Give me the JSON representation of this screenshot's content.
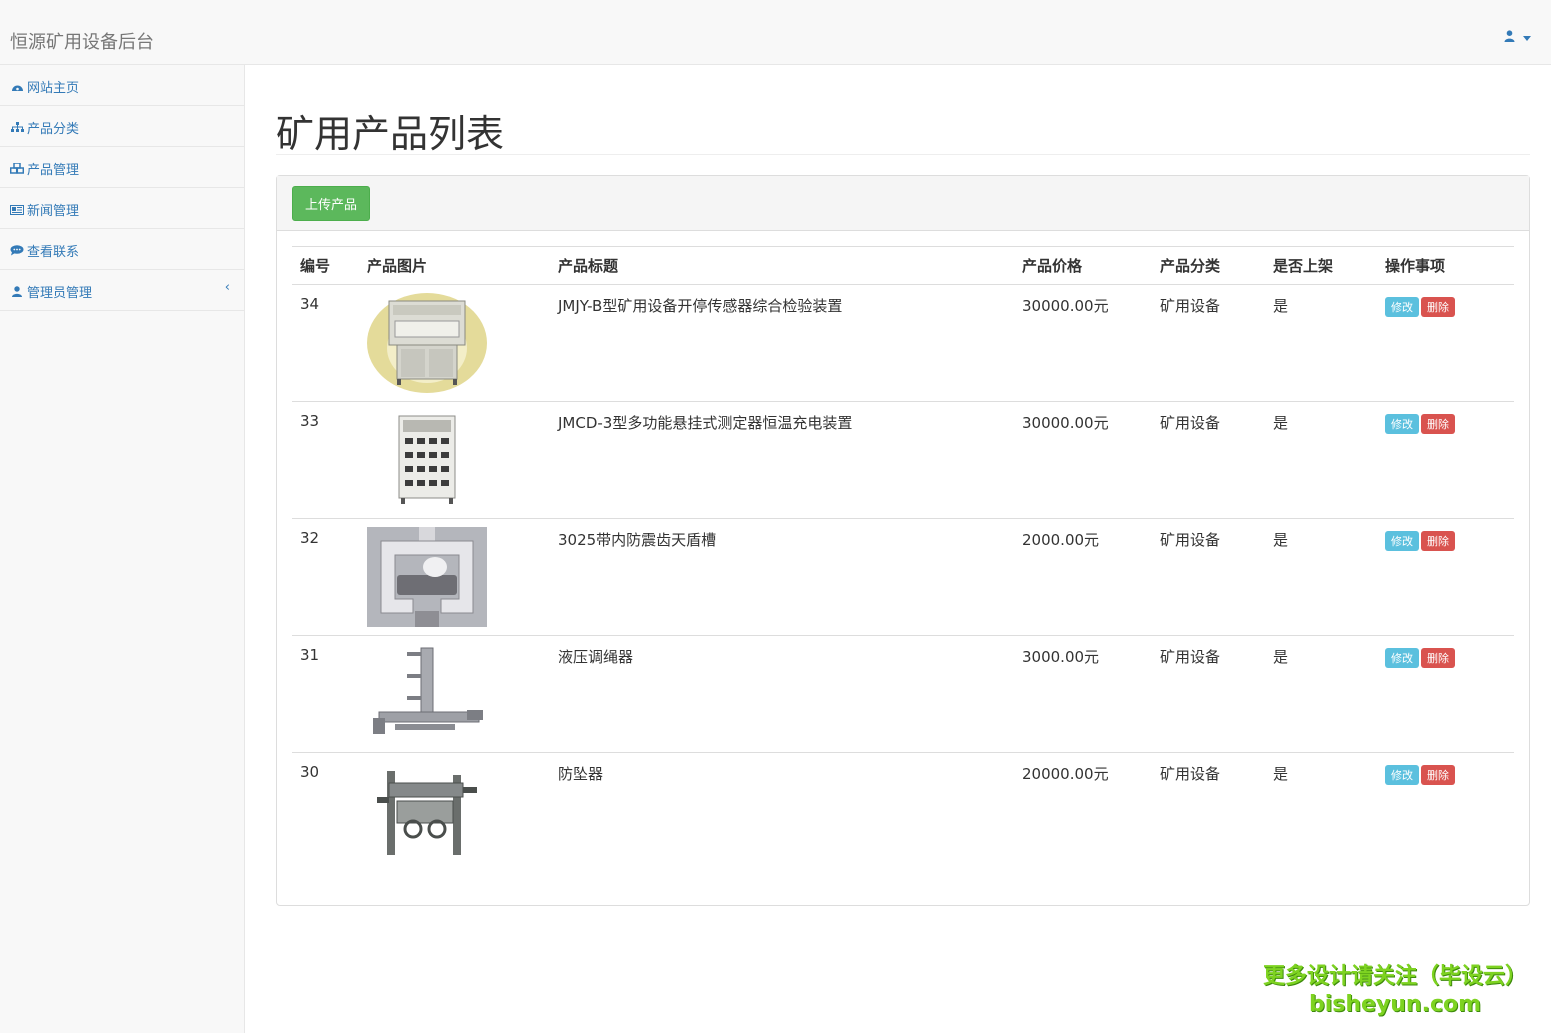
{
  "header": {
    "brand": "恒源矿用设备后台",
    "user_icon": "user-icon"
  },
  "sidebar": {
    "items": [
      {
        "label": "网站主页",
        "icon": "dashboard-icon"
      },
      {
        "label": "产品分类",
        "icon": "sitemap-icon"
      },
      {
        "label": "产品管理",
        "icon": "cubes-icon"
      },
      {
        "label": "新闻管理",
        "icon": "newspaper-icon"
      },
      {
        "label": "查看联系",
        "icon": "comments-icon"
      },
      {
        "label": "管理员管理",
        "icon": "user-icon",
        "arrow": "‹"
      }
    ]
  },
  "main": {
    "title": "矿用产品列表",
    "upload_button": "上传产品",
    "columns": [
      "编号",
      "产品图片",
      "产品标题",
      "产品价格",
      "产品分类",
      "是否上架",
      "操作事项"
    ],
    "rows": [
      {
        "id": "34",
        "title": "JMJY-B型矿用设备开停传感器综合检验装置",
        "price": "30000.00元",
        "category": "矿用设备",
        "listed": "是",
        "edit": "修改",
        "delete": "删除"
      },
      {
        "id": "33",
        "title": "JMCD-3型多功能悬挂式测定器恒温充电装置",
        "price": "30000.00元",
        "category": "矿用设备",
        "listed": "是",
        "edit": "修改",
        "delete": "删除"
      },
      {
        "id": "32",
        "title": "3025带内防震齿天盾槽",
        "price": "2000.00元",
        "category": "矿用设备",
        "listed": "是",
        "edit": "修改",
        "delete": "删除"
      },
      {
        "id": "31",
        "title": "液压调绳器",
        "price": "3000.00元",
        "category": "矿用设备",
        "listed": "是",
        "edit": "修改",
        "delete": "删除"
      },
      {
        "id": "30",
        "title": "防坠器",
        "price": "20000.00元",
        "category": "矿用设备",
        "listed": "是",
        "edit": "修改",
        "delete": "删除"
      }
    ]
  },
  "watermark": {
    "line1": "更多设计请关注（毕设云）",
    "line2": "bisheyun.com"
  },
  "colors": {
    "link": "#337ab7",
    "success": "#5cb85c",
    "info": "#5bc0de",
    "danger": "#d9534f"
  }
}
